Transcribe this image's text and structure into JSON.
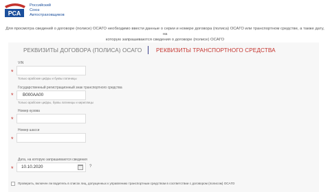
{
  "logo": {
    "line1": "Российский",
    "line2": "Союз",
    "line3": "Автостраховщиков"
  },
  "intro": {
    "line1": "Для просмотра сведений о договоре (полисе) ОСАГО необходимо ввести данные о серии и номере договора (полиса) ОСАГО или транспортном средстве, а также дату, на",
    "line2": "которую запрашиваются сведения о договоре (полисе) ОСАГО"
  },
  "tabs": {
    "policy": "РЕКВИЗИТЫ ДОГОВОРА (ПОЛИСА) ОСАГО",
    "vehicle": "РЕКВИЗИТЫ ТРАНСПОРТНОГО СРЕДСТВА"
  },
  "form": {
    "vin_label": "VIN",
    "vin_hint": "Только арабские цифры и буквы латиницы",
    "plate_label": "Государственный регистрационный знак транспортного средства",
    "plate_placeholder": "В000АА00",
    "plate_hint": "Только арабские цифры, буквы латиницы и кириллицы",
    "body_label": "Номер кузова",
    "chassis_label": "Номер шасси",
    "date_label": "Дата, на которую запрашиваются сведения",
    "date_value": "10.10.2020",
    "date_help": "?"
  },
  "consent": {
    "text": "Проверить, включен ли водитель в список лиц, допущенных к управлению транспортным средством в соответствии с договором (полисом) ОСАГО"
  },
  "colors": {
    "accent": "#c4322c",
    "brand": "#1b4f9c"
  }
}
